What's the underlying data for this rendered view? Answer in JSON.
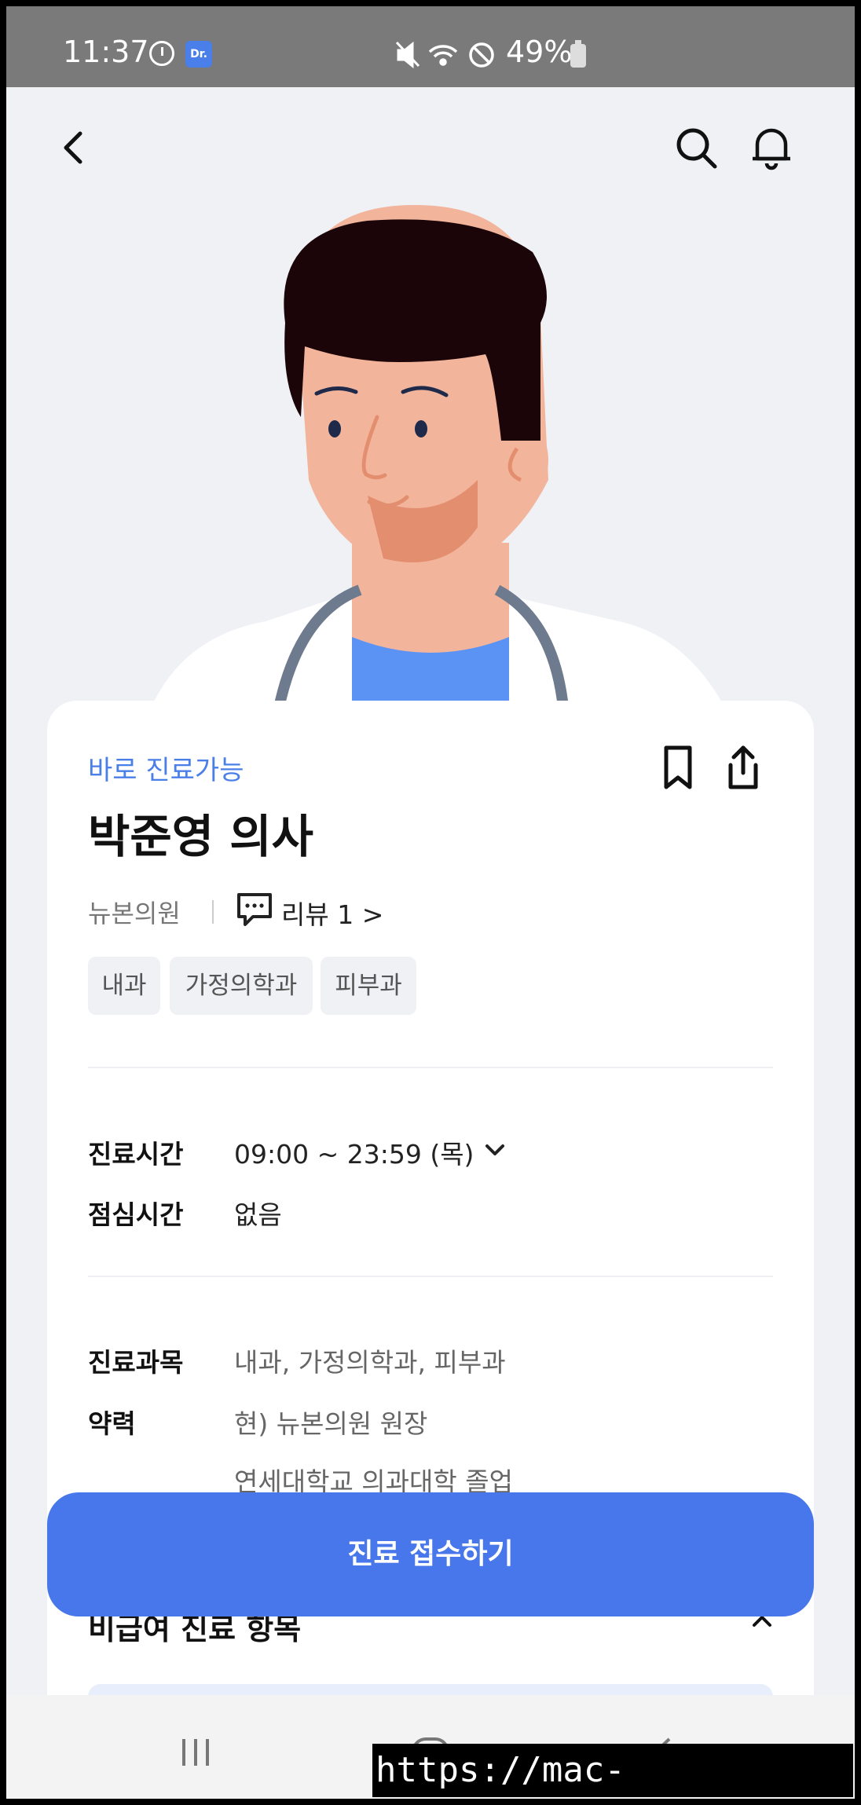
{
  "status_bar": {
    "time": "11:37",
    "app_badge": "Dr.",
    "battery_percent": "49%",
    "icons": [
      "clock-icon",
      "mute-icon",
      "wifi-icon",
      "do-not-disturb-icon",
      "battery-icon"
    ]
  },
  "topbar": {
    "back_icon": "chevron-left-icon",
    "search_icon": "search-icon",
    "notification_icon": "bell-icon"
  },
  "doctor": {
    "availability": "바로 진료가능",
    "name": "박준영 의사",
    "clinic": "뉴본의원",
    "review_label": "리뷰 1 >",
    "tags": [
      "내과",
      "가정의학과",
      "피부과"
    ]
  },
  "hours": {
    "label": "진료시간",
    "value": "09:00 ~ 23:59 (목)",
    "lunch_label": "점심시간",
    "lunch_value": "없음"
  },
  "info": {
    "department_label": "진료과목",
    "department_value": "내과, 가정의학과, 피부과",
    "career_label": "약력",
    "career_lines": [
      "현) 뉴본의원 원장",
      "연세대학교 의과대학 졸업"
    ]
  },
  "partial_section_title": "비급여 진료 항목",
  "cta": {
    "label": "진료 접수하기"
  },
  "watermark": "https://mac-os.tistory.com",
  "colors": {
    "accent": "#4777ea",
    "background": "#eff1f5"
  }
}
